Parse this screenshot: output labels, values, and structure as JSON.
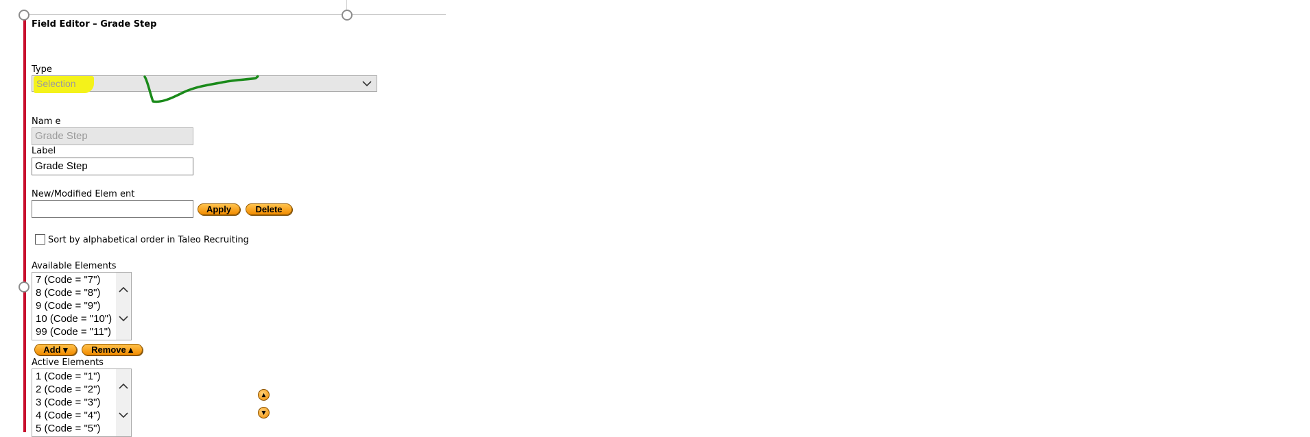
{
  "editor": {
    "title": "Field Editor – Grade Step",
    "type": {
      "label": "Type",
      "selected": "Selection"
    },
    "name": {
      "label": "Nam e",
      "value": "Grade Step"
    },
    "label_field": {
      "label": "Label",
      "value": "Grade Step"
    },
    "new_element": {
      "label": "New/Modified Elem ent",
      "value": "",
      "apply_label": "Apply",
      "delete_label": "Delete"
    },
    "sort": {
      "label": "Sort by alphabetical order in Taleo Recruiting",
      "checked": false
    },
    "available": {
      "label": "Available Elements",
      "items": [
        "7 (Code = \"7\")",
        "8 (Code = \"8\")",
        "9 (Code = \"9\")",
        "10 (Code = \"10\")",
        "99 (Code = \"11\")"
      ]
    },
    "add_label": "Add ▾",
    "remove_label": "Remove ▴",
    "active": {
      "label": "Active Elements",
      "items": [
        "1 (Code = \"1\")",
        "2 (Code = \"2\")",
        "3 (Code = \"3\")",
        "4 (Code = \"4\")",
        "5 (Code = \"5\")"
      ]
    },
    "move_up_glyph": "▲",
    "move_down_glyph": "▼"
  },
  "colors": {
    "accent_red": "#c8102e",
    "button_orange": "#f7a21b",
    "highlight_yellow": "#f4f21a",
    "annotation_green": "#1a8a1a"
  },
  "icons": {
    "select_arrow": "chevron-down-icon",
    "scroll_up": "chevron-up-icon",
    "scroll_down": "chevron-down-icon"
  }
}
